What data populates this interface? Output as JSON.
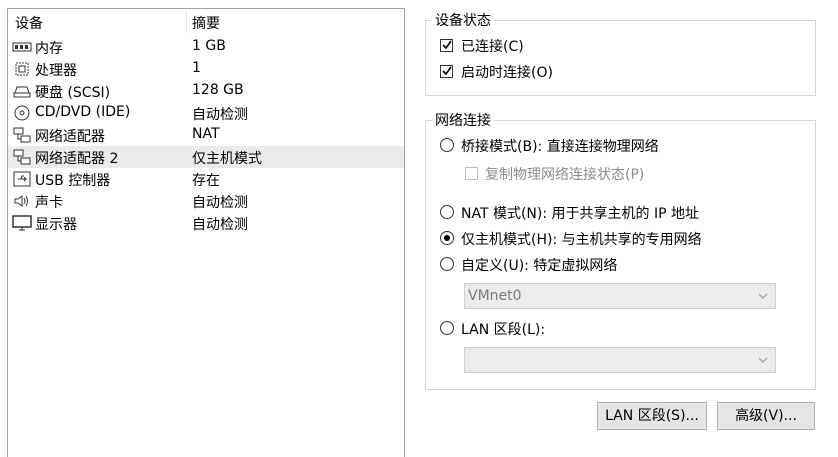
{
  "device_list": {
    "headers": {
      "device": "设备",
      "summary": "摘要"
    },
    "rows": [
      {
        "name": "内存",
        "summary": "1 GB",
        "icon": "memory-icon",
        "selected": false
      },
      {
        "name": "处理器",
        "summary": "1",
        "icon": "processor-icon",
        "selected": false
      },
      {
        "name": "硬盘 (SCSI)",
        "summary": "128 GB",
        "icon": "hard-disk-icon",
        "selected": false
      },
      {
        "name": "CD/DVD (IDE)",
        "summary": "自动检测",
        "icon": "cd-dvd-icon",
        "selected": false
      },
      {
        "name": "网络适配器",
        "summary": "NAT",
        "icon": "network-adapter-icon",
        "selected": false
      },
      {
        "name": "网络适配器 2",
        "summary": "仅主机模式",
        "icon": "network-adapter-icon",
        "selected": true
      },
      {
        "name": "USB 控制器",
        "summary": "存在",
        "icon": "usb-icon",
        "selected": false
      },
      {
        "name": "声卡",
        "summary": "自动检测",
        "icon": "sound-card-icon",
        "selected": false
      },
      {
        "name": "显示器",
        "summary": "自动检测",
        "icon": "display-icon",
        "selected": false
      }
    ]
  },
  "device_status": {
    "legend": "设备状态",
    "connected": {
      "label": "已连接(C)",
      "checked": true
    },
    "connect_at_power_on": {
      "label": "启动时连接(O)",
      "checked": true
    }
  },
  "network_connection": {
    "legend": "网络连接",
    "bridged": {
      "label": "桥接模式(B): 直接连接物理网络",
      "selected": false
    },
    "replicate": {
      "label": "复制物理网络连接状态(P)",
      "checked": false,
      "enabled": false
    },
    "nat": {
      "label": "NAT 模式(N): 用于共享主机的 IP 地址",
      "selected": false
    },
    "host_only": {
      "label": "仅主机模式(H): 与主机共享的专用网络",
      "selected": true
    },
    "custom": {
      "label": "自定义(U): 特定虚拟网络",
      "selected": false
    },
    "custom_select_value": "VMnet0",
    "lan_segment": {
      "label": "LAN 区段(L):",
      "selected": false
    },
    "lan_select_value": ""
  },
  "buttons": {
    "lan_segments": "LAN 区段(S)...",
    "advanced": "高级(V)..."
  },
  "colors": {
    "selected_row": "#ebebeb",
    "button_bg": "#e5e5e5",
    "disabled_text": "#8c8c8c"
  }
}
